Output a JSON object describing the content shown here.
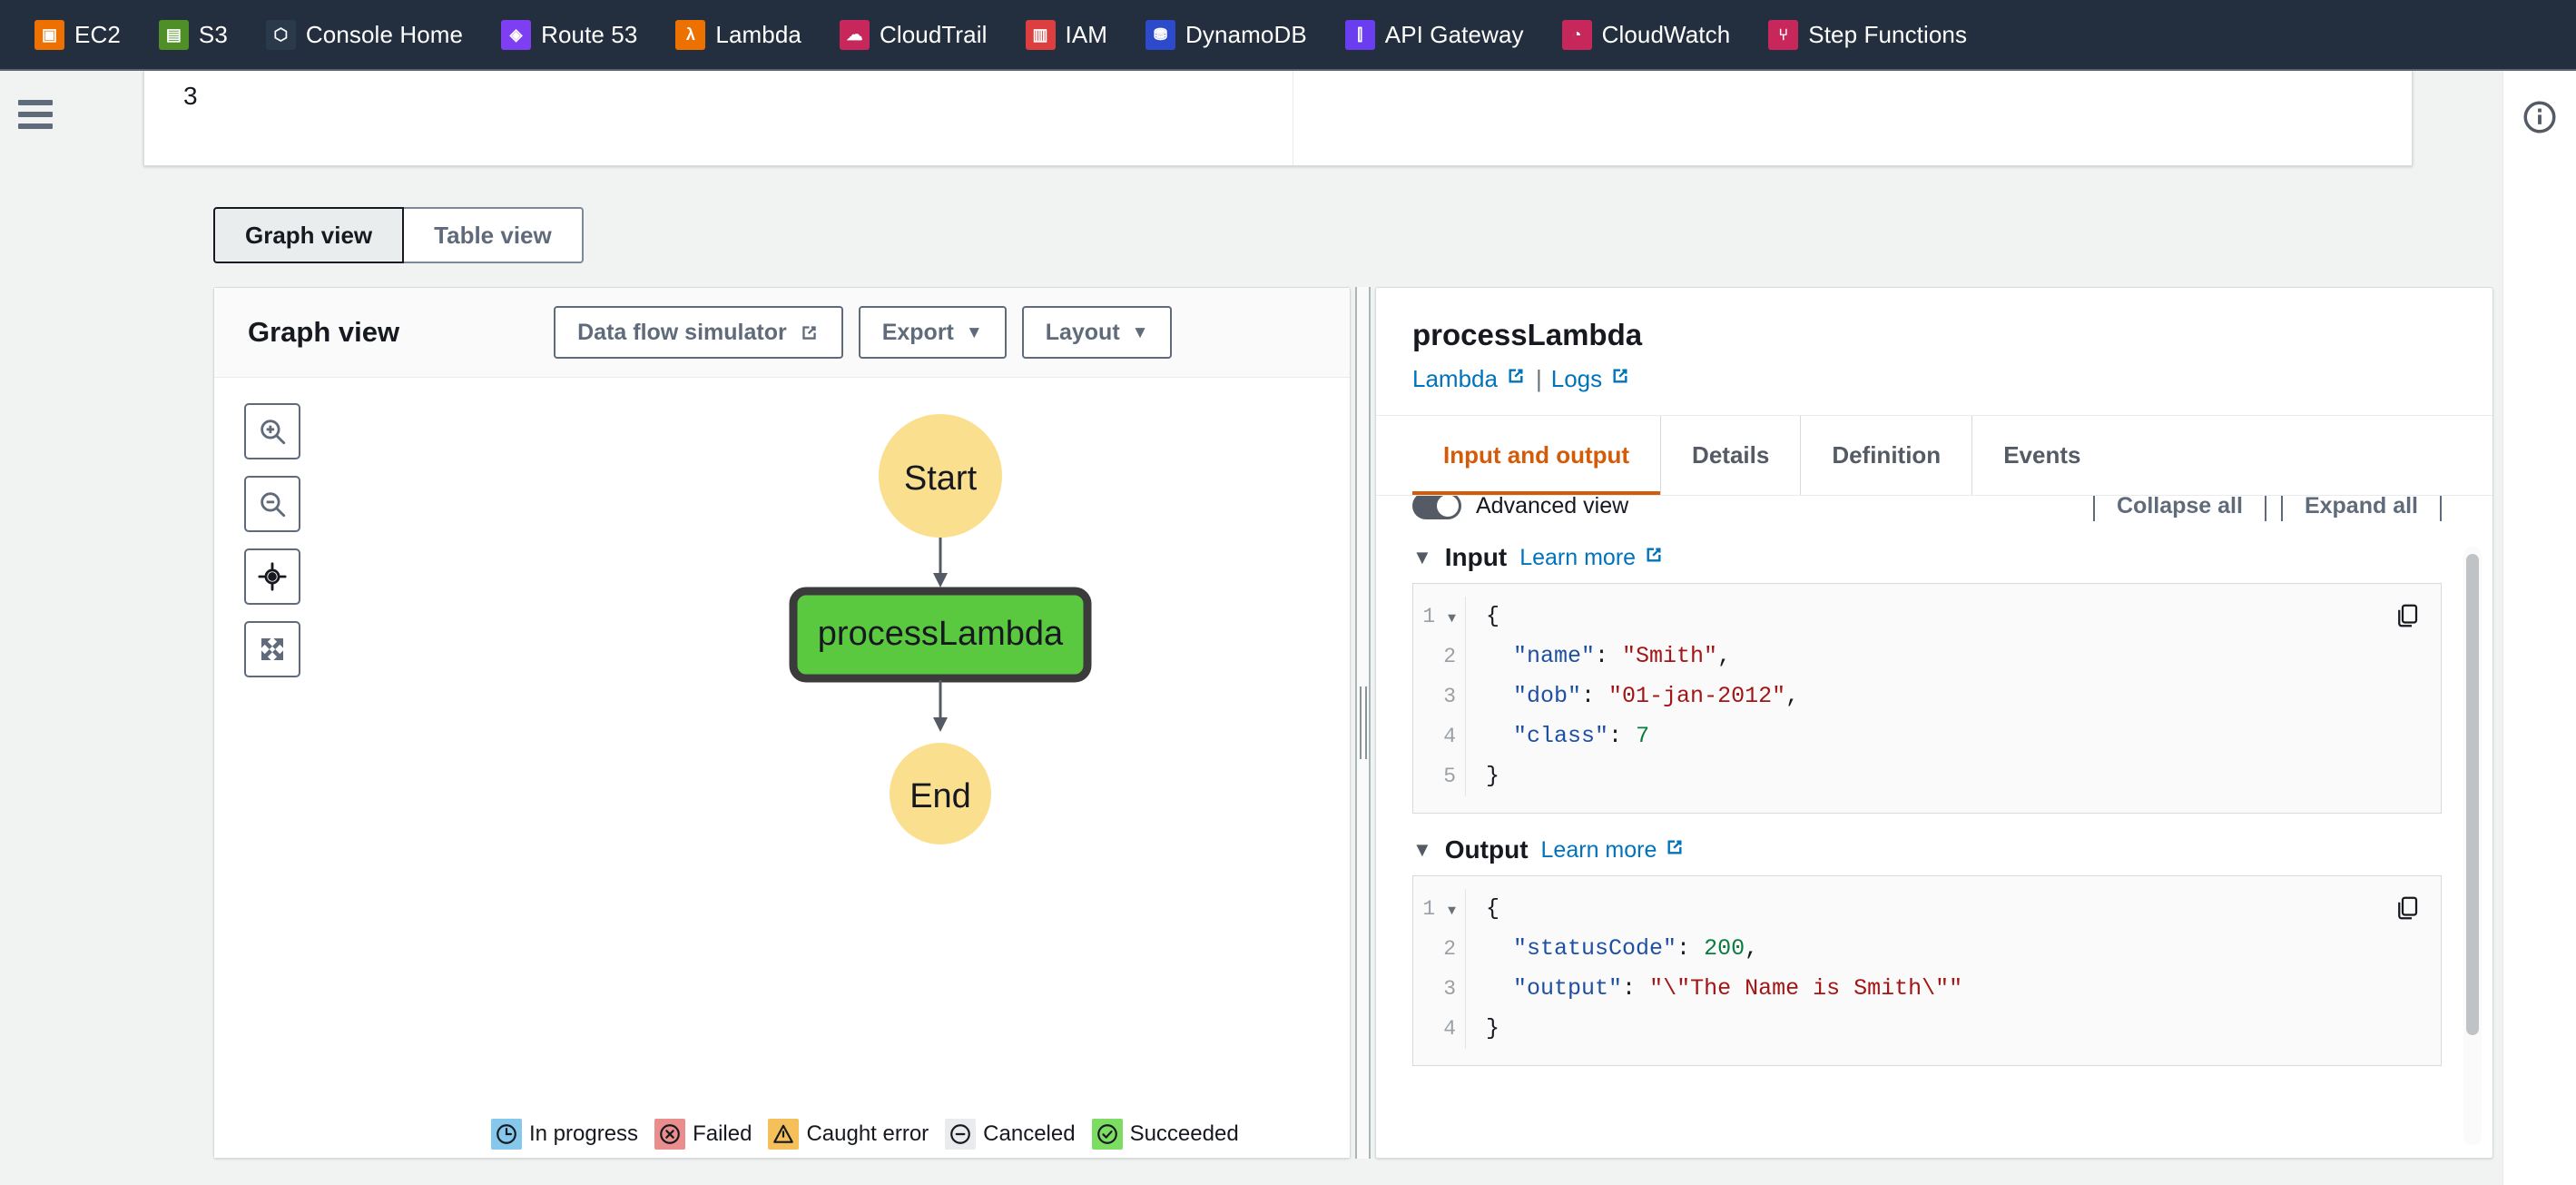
{
  "topnav": {
    "items": [
      {
        "label": "EC2",
        "icon": "ec2-icon",
        "color": "#ed7100",
        "glyph": "▣"
      },
      {
        "label": "S3",
        "icon": "s3-icon",
        "color": "#4f8f27",
        "glyph": "▤"
      },
      {
        "label": "Console Home",
        "icon": "console-home-icon",
        "color": "#2b3a4a",
        "glyph": "⬡"
      },
      {
        "label": "Route 53",
        "icon": "route53-icon",
        "color": "#7e3ff2",
        "glyph": "◈"
      },
      {
        "label": "Lambda",
        "icon": "lambda-icon",
        "color": "#ed7100",
        "glyph": "λ"
      },
      {
        "label": "CloudTrail",
        "icon": "cloudtrail-icon",
        "color": "#c7275b",
        "glyph": "☁"
      },
      {
        "label": "IAM",
        "icon": "iam-icon",
        "color": "#dd3f41",
        "glyph": "▥"
      },
      {
        "label": "DynamoDB",
        "icon": "dynamodb-icon",
        "color": "#2d4acb",
        "glyph": "⛃"
      },
      {
        "label": "API Gateway",
        "icon": "api-gateway-icon",
        "color": "#6b3df0",
        "glyph": "⫿"
      },
      {
        "label": "CloudWatch",
        "icon": "cloudwatch-icon",
        "color": "#c7275b",
        "glyph": "◔"
      },
      {
        "label": "Step Functions",
        "icon": "step-functions-icon",
        "color": "#c7275b",
        "glyph": "⑂"
      }
    ]
  },
  "topcard": {
    "number": "3"
  },
  "view_toggle": {
    "graph_view": "Graph view",
    "table_view": "Table view",
    "active": "Graph view"
  },
  "graph_panel": {
    "title": "Graph view",
    "buttons": {
      "data_flow_simulator": "Data flow simulator",
      "export": "Export",
      "layout": "Layout"
    },
    "zoom_controls": [
      {
        "name": "zoom-in-icon"
      },
      {
        "name": "zoom-out-icon"
      },
      {
        "name": "center-focus-icon"
      },
      {
        "name": "fit-screen-icon"
      }
    ],
    "diagram": {
      "start_label": "Start",
      "state_label": "processLambda",
      "end_label": "End",
      "start_color": "#fadf8e",
      "state_color": "#5bc93f",
      "state_border": "#3b3b3b"
    },
    "legend": [
      {
        "label": "In progress",
        "icon": "clock-icon",
        "bg": "#85c8ec"
      },
      {
        "label": "Failed",
        "icon": "x-circle-icon",
        "bg": "#e98d8d"
      },
      {
        "label": "Caught error",
        "icon": "warning-icon",
        "bg": "#f5c05a"
      },
      {
        "label": "Canceled",
        "icon": "minus-circle-icon",
        "bg": "#e9ebed"
      },
      {
        "label": "Succeeded",
        "icon": "check-circle-icon",
        "bg": "#7ddd63"
      }
    ]
  },
  "detail_panel": {
    "title": "processLambda",
    "links": {
      "lambda": "Lambda",
      "separator": "|",
      "logs": "Logs"
    },
    "tabs": [
      {
        "label": "Input and output",
        "active": true
      },
      {
        "label": "Details",
        "active": false
      },
      {
        "label": "Definition",
        "active": false
      },
      {
        "label": "Events",
        "active": false
      }
    ],
    "advanced_view_label": "Advanced view",
    "collapse_all": "Collapse all",
    "expand_all": "Expand all",
    "input": {
      "title": "Input",
      "learn_more": "Learn more",
      "lines": [
        {
          "no": "1",
          "fold": true,
          "html": "{"
        },
        {
          "no": "2",
          "fold": false,
          "html": "  <span class=\"k\">\"name\"</span>: <span class=\"s\">\"Smith\"</span>,"
        },
        {
          "no": "3",
          "fold": false,
          "html": "  <span class=\"k\">\"dob\"</span>: <span class=\"s\">\"01-jan-2012\"</span>,"
        },
        {
          "no": "4",
          "fold": false,
          "html": "  <span class=\"k\">\"class\"</span>: <span class=\"n\">7</span>"
        },
        {
          "no": "5",
          "fold": false,
          "html": "}"
        }
      ]
    },
    "output": {
      "title": "Output",
      "learn_more": "Learn more",
      "lines": [
        {
          "no": "1",
          "fold": true,
          "html": "{"
        },
        {
          "no": "2",
          "fold": false,
          "html": "  <span class=\"k\">\"statusCode\"</span>: <span class=\"n\">200</span>,"
        },
        {
          "no": "3",
          "fold": false,
          "html": "  <span class=\"k\">\"output\"</span>: <span class=\"s\">\"\\\"The Name is Smith\\\"\"</span>"
        },
        {
          "no": "4",
          "fold": false,
          "html": "}"
        }
      ]
    }
  },
  "right_rail": {
    "info_icon": "info-icon"
  }
}
